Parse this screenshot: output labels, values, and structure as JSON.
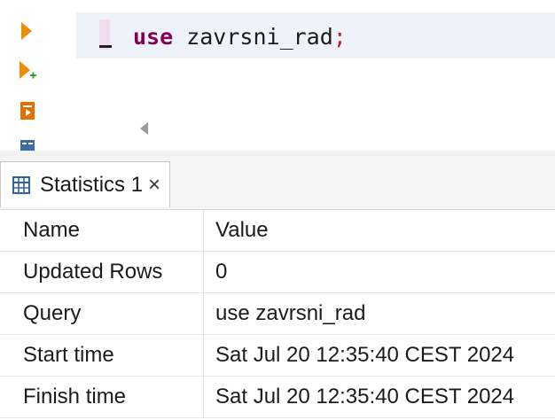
{
  "editor": {
    "toolbar": {
      "icons": [
        "run-statement-icon",
        "run-in-new-tab-icon",
        "execute-script-icon",
        "explain-plan-icon"
      ],
      "colors": {
        "run": "#f08c00",
        "run_plus": "#3a9a3a",
        "script": "#e07000",
        "explain": "#3a6ea5"
      }
    },
    "code": {
      "keyword": "use",
      "identifier": " zavrsni_rad",
      "terminator": ";"
    },
    "colors": {
      "keyword": "#7f0055",
      "terminator": "#d01c1c",
      "line_highlight": "#eef3fb",
      "marker": "#f0dcee"
    }
  },
  "results": {
    "tab": {
      "label": "Statistics 1",
      "close": "×",
      "icon": "table-grid-icon"
    },
    "columns": {
      "name": "Name",
      "value": "Value"
    },
    "rows": [
      {
        "name": "Updated Rows",
        "value": "0"
      },
      {
        "name": "Query",
        "value": "use zavrsni_rad"
      },
      {
        "name": "Start time",
        "value": "Sat Jul 20 12:35:40 CEST 2024"
      },
      {
        "name": "Finish time",
        "value": "Sat Jul 20 12:35:40 CEST 2024"
      }
    ]
  }
}
